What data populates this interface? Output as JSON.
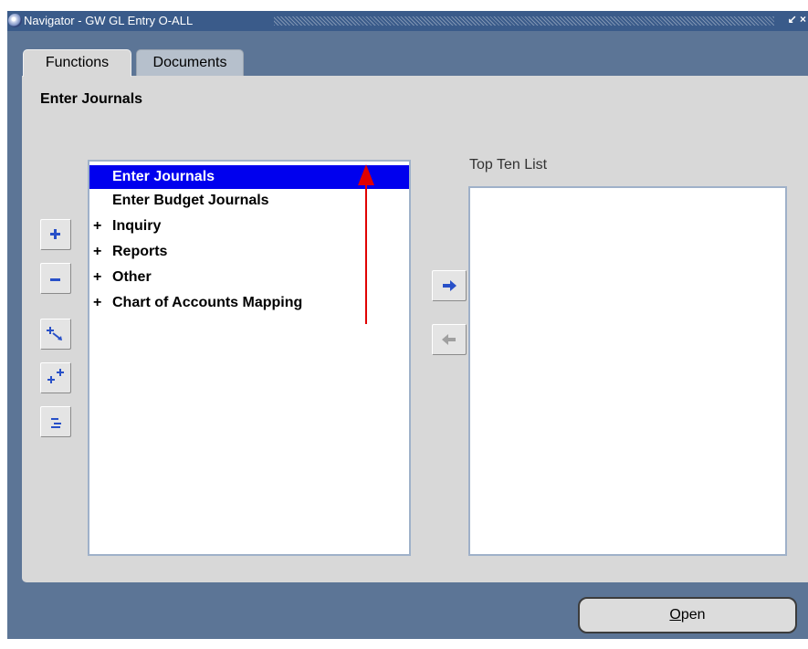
{
  "window": {
    "title": "Navigator - GW GL Entry O-ALL",
    "controls": "↙ ×"
  },
  "tabs": [
    {
      "label": "Functions",
      "active": true
    },
    {
      "label": "Documents",
      "active": false
    }
  ],
  "panel": {
    "title": "Enter Journals"
  },
  "functions_list": {
    "items": [
      {
        "expander": "",
        "label": "Enter Journals",
        "selected": true
      },
      {
        "expander": "",
        "label": "Enter Budget Journals",
        "selected": false
      },
      {
        "expander": "+",
        "label": "Inquiry",
        "selected": false
      },
      {
        "expander": "+",
        "label": "Reports",
        "selected": false
      },
      {
        "expander": "+",
        "label": "Other",
        "selected": false
      },
      {
        "expander": "+",
        "label": "Chart of Accounts Mapping",
        "selected": false
      }
    ]
  },
  "side_buttons": [
    {
      "icon": "expand-plus-icon"
    },
    {
      "icon": "collapse-minus-icon"
    },
    {
      "icon": "expand-branch-icon"
    },
    {
      "icon": "expand-all-icon"
    },
    {
      "icon": "collapse-all-icon"
    }
  ],
  "top_ten": {
    "label": "Top Ten List"
  },
  "footer": {
    "open_prefix": "O",
    "open_rest": "pen"
  },
  "colors": {
    "selection": "#0000ee",
    "background": "#5c7596",
    "panel": "#d8d8d8",
    "annotation_arrow": "#e00000"
  }
}
